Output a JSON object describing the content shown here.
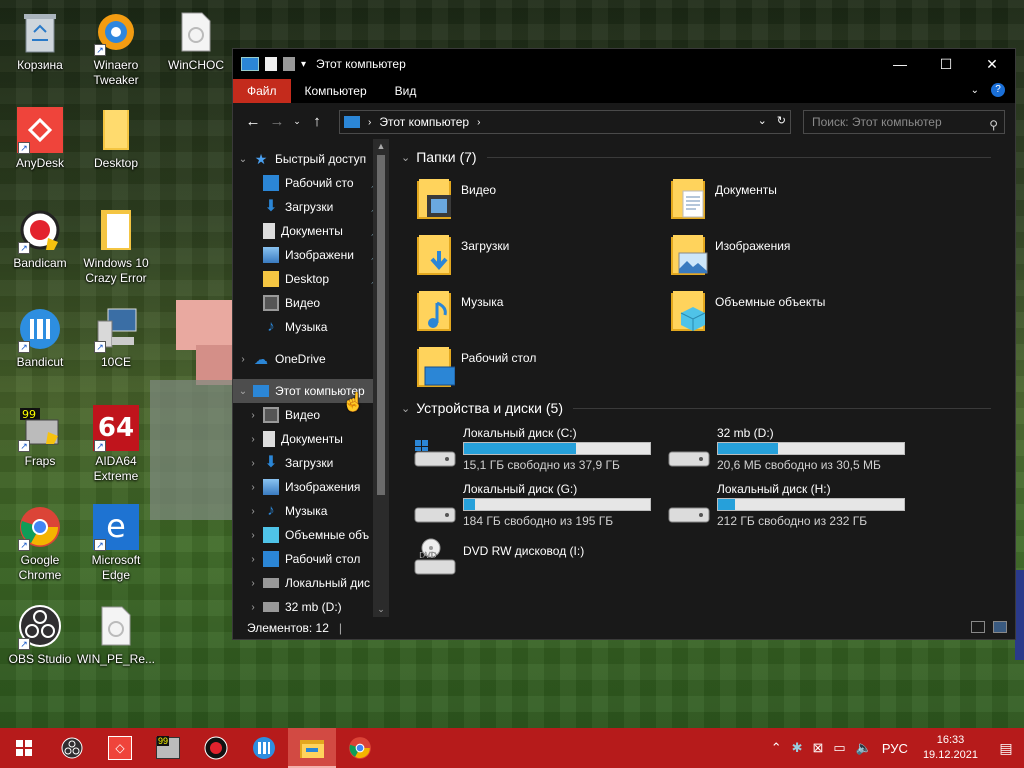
{
  "desktop": {
    "icons": [
      {
        "label": "Корзина"
      },
      {
        "label": "Winaero Tweaker"
      },
      {
        "label": "WinCHOC"
      },
      {
        "label": "AnyDesk"
      },
      {
        "label": "Desktop"
      },
      {
        "label": "Bandicam"
      },
      {
        "label": "Windows 10 Crazy Error"
      },
      {
        "label": "Bandicut"
      },
      {
        "label": "10CE"
      },
      {
        "label": "Fraps"
      },
      {
        "label": "AIDA64 Extreme"
      },
      {
        "label": "Google Chrome"
      },
      {
        "label": "Microsoft Edge"
      },
      {
        "label": "OBS Studio"
      },
      {
        "label": "WIN_PE_Re..."
      }
    ]
  },
  "window": {
    "title": "Этот компьютер",
    "controls": {
      "minimize": "—",
      "maximize": "☐",
      "close": "✕"
    },
    "ribbon_tabs": [
      "Файл",
      "Компьютер",
      "Вид"
    ],
    "address": {
      "path": "Этот компьютер"
    },
    "search": {
      "placeholder": "Поиск: Этот компьютер"
    },
    "nav": {
      "quick_access": "Быстрый доступ",
      "quick_items": [
        "Рабочий сто",
        "Загрузки",
        "Документы",
        "Изображени",
        "Desktop",
        "Видео",
        "Музыка"
      ],
      "onedrive": "OneDrive",
      "this_pc": "Этот компьютер",
      "pc_items": [
        "Видео",
        "Документы",
        "Загрузки",
        "Изображения",
        "Музыка",
        "Объемные объ",
        "Рабочий стол",
        "Локальный дис",
        "32 mb (D:)"
      ]
    },
    "folders_header": "Папки (7)",
    "folders": [
      {
        "name": "Видео",
        "icon": "video-folder-icon"
      },
      {
        "name": "Документы",
        "icon": "documents-folder-icon"
      },
      {
        "name": "Загрузки",
        "icon": "downloads-folder-icon"
      },
      {
        "name": "Изображения",
        "icon": "pictures-folder-icon"
      },
      {
        "name": "Музыка",
        "icon": "music-folder-icon"
      },
      {
        "name": "Объемные объекты",
        "icon": "3d-objects-folder-icon"
      },
      {
        "name": "Рабочий стол",
        "icon": "desktop-folder-icon"
      }
    ],
    "drives_header": "Устройства и диски (5)",
    "drives": [
      {
        "name": "Локальный диск (C:)",
        "free": "15,1 ГБ свободно из 37,9 ГБ",
        "used_fraction": 0.6
      },
      {
        "name": "32 mb (D:)",
        "free": "20,6 МБ свободно из 30,5 МБ",
        "used_fraction": 0.32
      },
      {
        "name": "Локальный диск (G:)",
        "free": "184 ГБ свободно из 195 ГБ",
        "used_fraction": 0.06
      },
      {
        "name": "Локальный диск (H:)",
        "free": "212 ГБ свободно из 232 ГБ",
        "used_fraction": 0.09
      },
      {
        "name": "DVD RW дисковод (I:)",
        "free": "",
        "used_fraction": null
      }
    ],
    "status": "Элементов: 12"
  },
  "taskbar": {
    "lang": "РУС",
    "time": "16:33",
    "date": "19.12.2021"
  },
  "colors": {
    "accent": "#c42b1c",
    "taskbar": "#b61b1b",
    "bar_fill": "#26a0da"
  }
}
